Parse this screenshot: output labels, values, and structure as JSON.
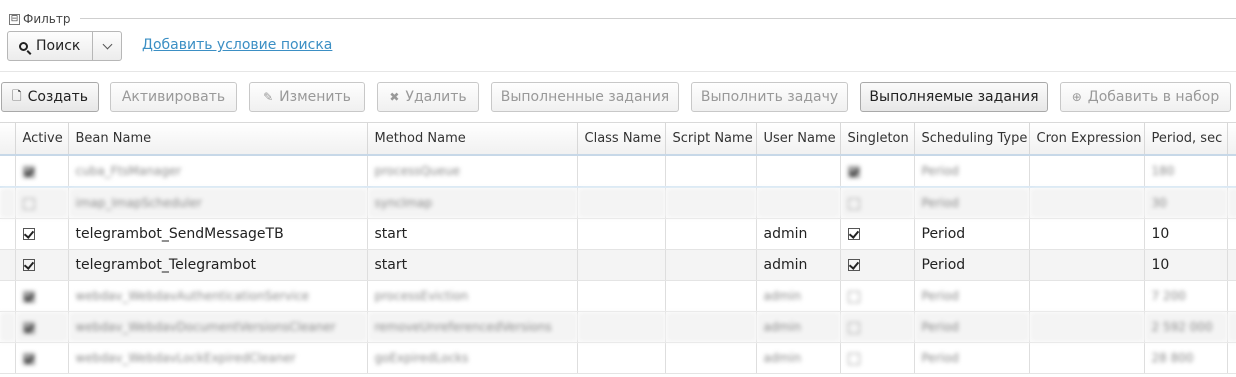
{
  "filter": {
    "toggle_symbol": "⊟",
    "title": "Фильтр",
    "search_label": "Поиск",
    "add_condition": "Добавить условие поиска"
  },
  "toolbar": {
    "create": "Создать",
    "activate": "Активировать",
    "edit": "Изменить",
    "delete": "Удалить",
    "executed_tasks": "Выполненные задания",
    "run_task": "Выполнить задачу",
    "running_tasks": "Выполняемые задания",
    "add_to_set": "Добавить в набор"
  },
  "table": {
    "columns": [
      "Active",
      "Bean Name",
      "Method Name",
      "Class Name",
      "Script Name",
      "User Name",
      "Singleton",
      "Scheduling Type",
      "Cron Expression",
      "Period, sec"
    ],
    "rows": [
      {
        "active": true,
        "bean": "cuba_FtsManager",
        "method": "processQueue",
        "class_name": "",
        "script": "",
        "user": "",
        "singleton": true,
        "type": "Period",
        "cron": "",
        "period": "180"
      },
      {
        "active": false,
        "bean": "imap_ImapScheduler",
        "method": "syncImap",
        "class_name": "",
        "script": "",
        "user": "",
        "singleton": false,
        "type": "Period",
        "cron": "",
        "period": "30"
      },
      {
        "active": true,
        "bean": "telegrambot_SendMessageTB",
        "method": "start",
        "class_name": "",
        "script": "",
        "user": "admin",
        "singleton": true,
        "type": "Period",
        "cron": "",
        "period": "10"
      },
      {
        "active": true,
        "bean": "telegrambot_Telegrambot",
        "method": "start",
        "class_name": "",
        "script": "",
        "user": "admin",
        "singleton": true,
        "type": "Period",
        "cron": "",
        "period": "10"
      },
      {
        "active": true,
        "bean": "webdav_WebdavAuthenticationService",
        "method": "processEviction",
        "class_name": "",
        "script": "",
        "user": "admin",
        "singleton": false,
        "type": "Period",
        "cron": "",
        "period": "7 200"
      },
      {
        "active": true,
        "bean": "webdav_WebdavDocumentVersionsCleaner",
        "method": "removeUnreferencedVersions",
        "class_name": "",
        "script": "",
        "user": "admin",
        "singleton": false,
        "type": "Period",
        "cron": "",
        "period": "2 592 000"
      },
      {
        "active": true,
        "bean": "webdav_WebdavLockExpiredCleaner",
        "method": "goExpiredLocks",
        "class_name": "",
        "script": "",
        "user": "admin",
        "singleton": false,
        "type": "Period",
        "cron": "",
        "period": "28 800"
      }
    ]
  }
}
